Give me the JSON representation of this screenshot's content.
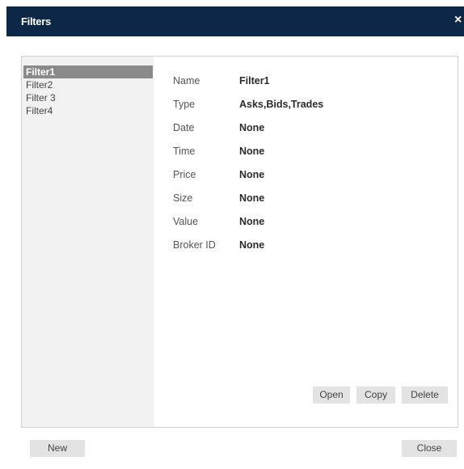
{
  "dialog": {
    "title": "Filters",
    "close_glyph": "×"
  },
  "filters": {
    "items": [
      {
        "label": "Filter1",
        "selected": true
      },
      {
        "label": "Filter2",
        "selected": false
      },
      {
        "label": "Filter 3",
        "selected": false
      },
      {
        "label": "Filter4",
        "selected": false
      }
    ]
  },
  "details": {
    "rows": [
      {
        "label": "Name",
        "value": "Filter1"
      },
      {
        "label": "Type",
        "value": "Asks,Bids,Trades"
      },
      {
        "label": "Date",
        "value": "None"
      },
      {
        "label": "Time",
        "value": "None"
      },
      {
        "label": "Price",
        "value": "None"
      },
      {
        "label": "Size",
        "value": "None"
      },
      {
        "label": "Value",
        "value": "None"
      },
      {
        "label": "Broker ID",
        "value": "None"
      }
    ]
  },
  "actions": {
    "open_label": "Open",
    "copy_label": "Copy",
    "delete_label": "Delete"
  },
  "footer": {
    "new_label": "New",
    "close_label": "Close"
  },
  "colors": {
    "titlebar": "#0d2747",
    "list_background": "#f2f2f2",
    "selected_item": "#8a8a8a",
    "button_background": "#e3e3e3"
  }
}
